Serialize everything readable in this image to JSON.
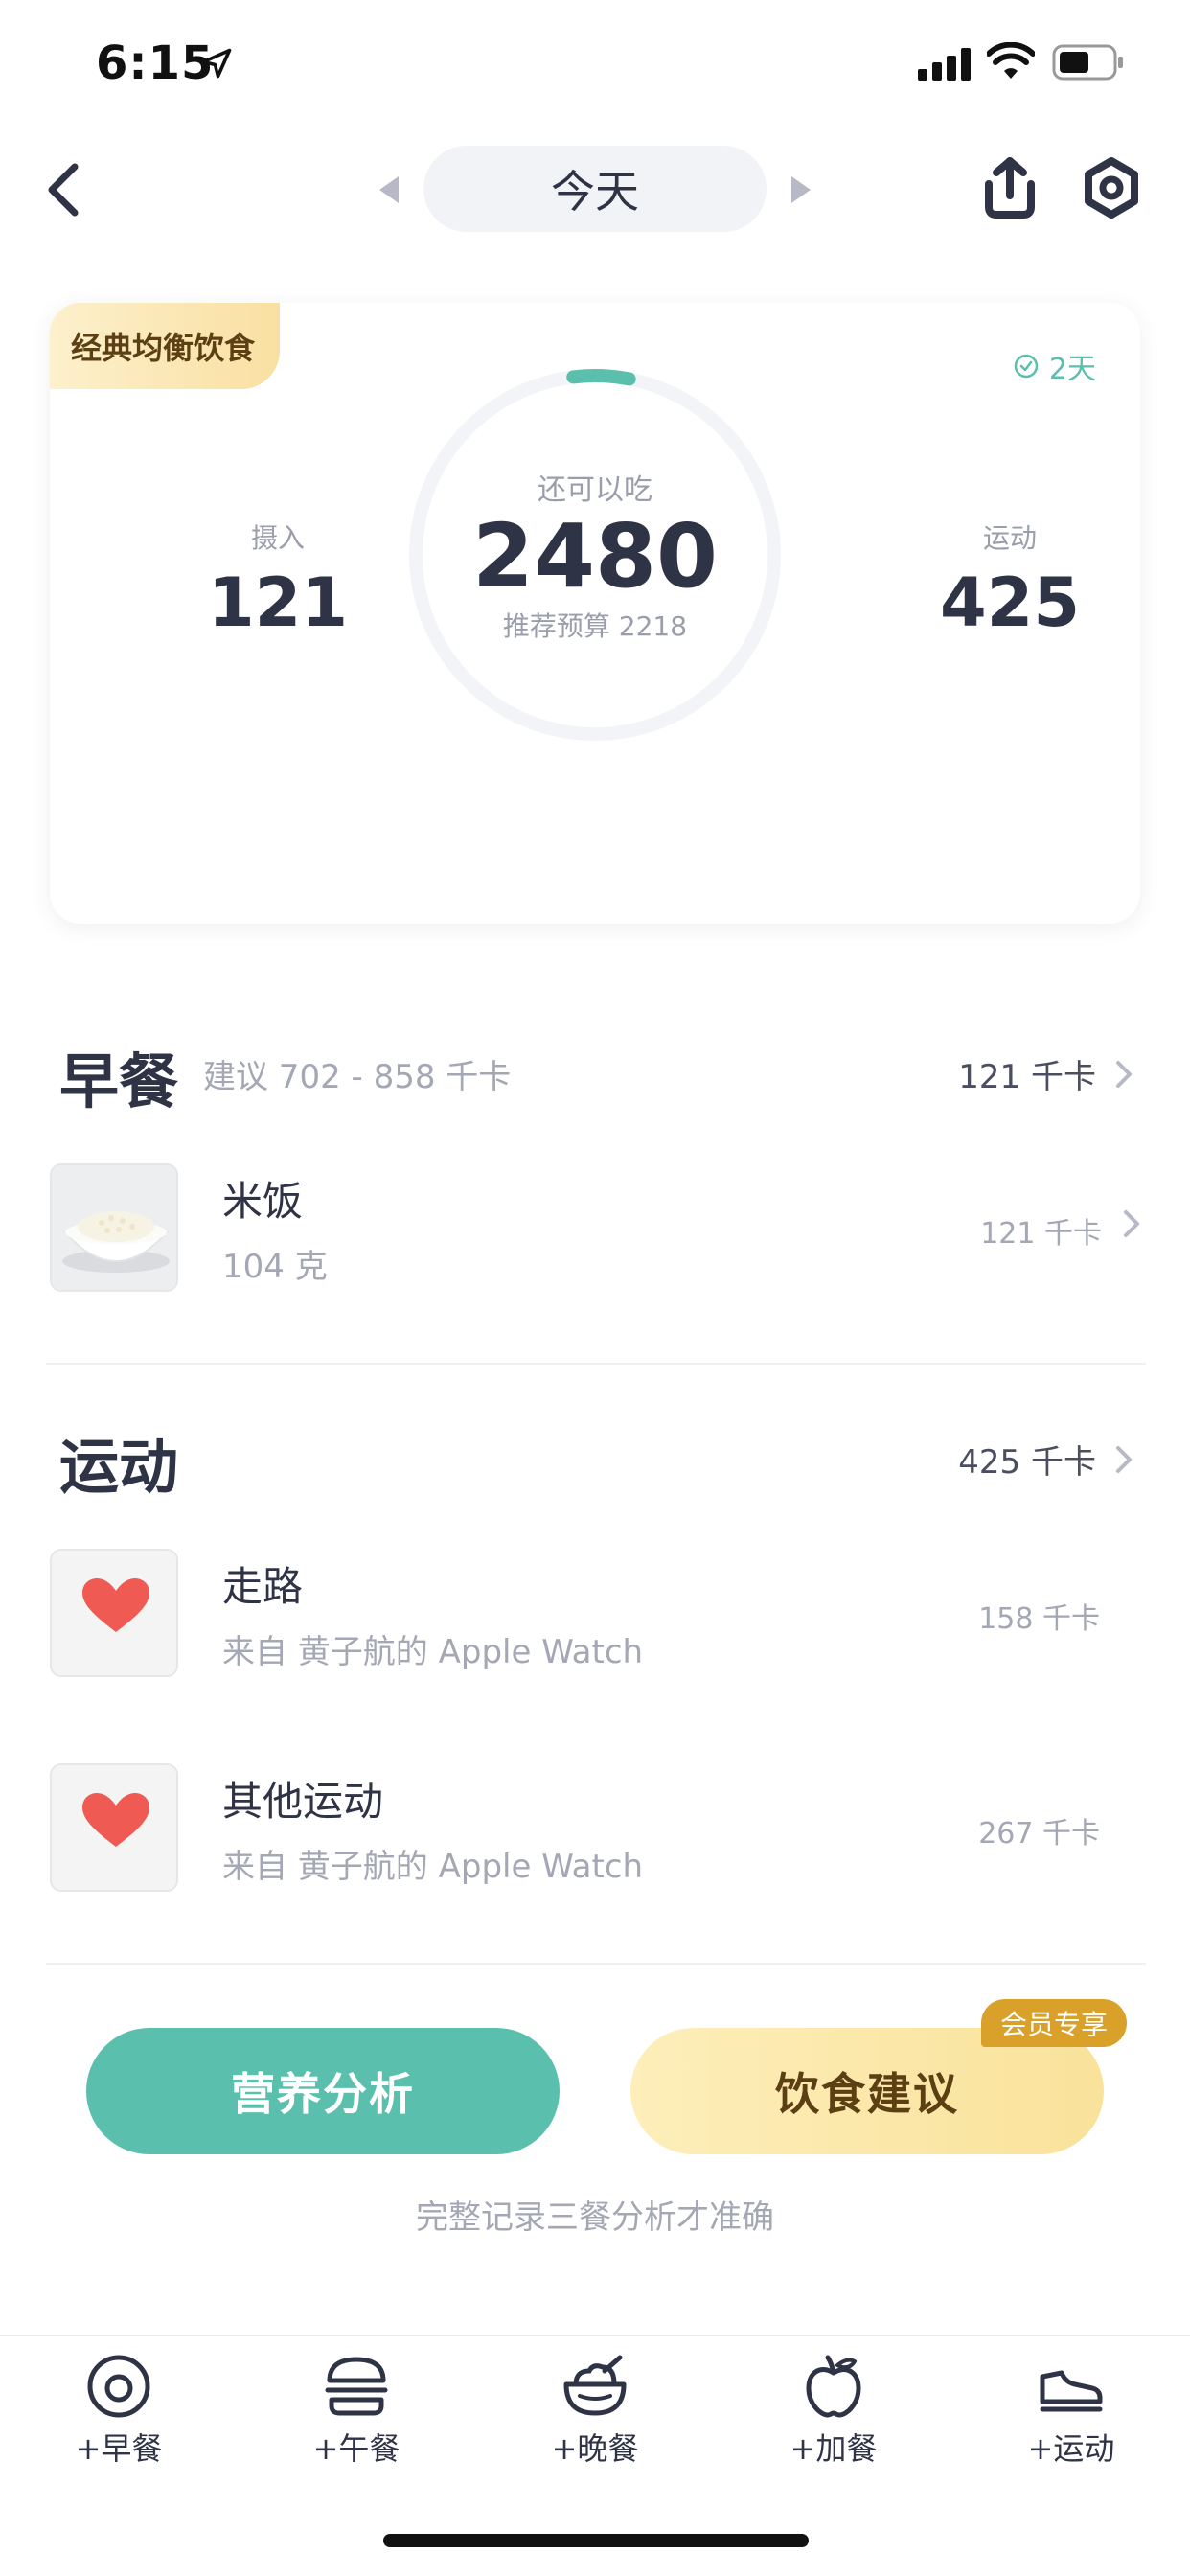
{
  "status_bar": {
    "time": "6:15"
  },
  "header": {
    "date_label": "今天"
  },
  "summary": {
    "diet_tag": "经典均衡饮食",
    "streak": "2天",
    "intake_label": "摄入",
    "intake_value": "121",
    "remaining_label": "还可以吃",
    "remaining_value": "2480",
    "budget_label": "推荐预算 2218",
    "exercise_label": "运动",
    "exercise_value": "425",
    "ring_progress": 0.05,
    "accent": "#5bbfae"
  },
  "breakfast": {
    "title": "早餐",
    "hint": "建议 702 - 858 千卡",
    "total": "121 千卡",
    "items": [
      {
        "name": "米饭",
        "sub": "104 克",
        "kcal": "121 千卡"
      }
    ]
  },
  "exercise": {
    "title": "运动",
    "total": "425 千卡",
    "items": [
      {
        "name": "走路",
        "sub": "来自 黄子航的 Apple Watch",
        "kcal": "158 千卡"
      },
      {
        "name": "其他运动",
        "sub": "来自 黄子航的 Apple Watch",
        "kcal": "267 千卡"
      }
    ]
  },
  "actions": {
    "analysis_label": "营养分析",
    "advice_label": "饮食建议",
    "vip_badge": "会员专享",
    "hint": "完整记录三餐分析才准确"
  },
  "bottom_nav": [
    {
      "label": "+早餐",
      "icon": "egg-icon"
    },
    {
      "label": "+午餐",
      "icon": "burger-icon"
    },
    {
      "label": "+晚餐",
      "icon": "bowl-icon"
    },
    {
      "label": "+加餐",
      "icon": "apple-icon"
    },
    {
      "label": "+运动",
      "icon": "sneaker-icon"
    }
  ]
}
